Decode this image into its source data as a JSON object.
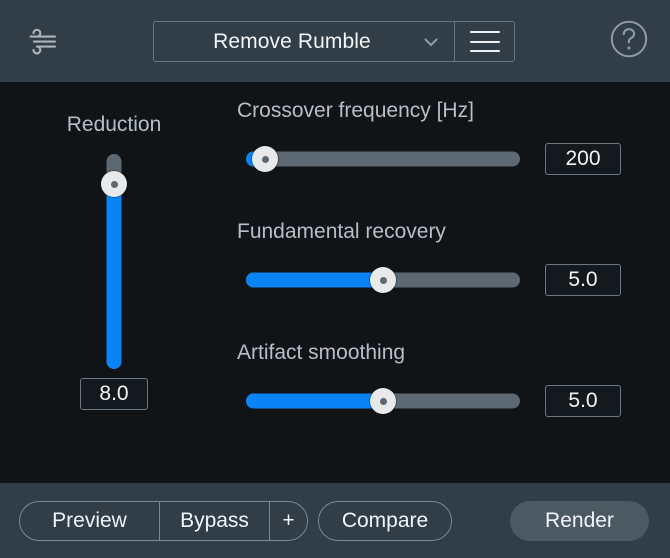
{
  "header": {
    "plugin_icon": "wind-noise-icon",
    "preset_name": "Remove Rumble",
    "dropdown_icon": "chevron-down-icon",
    "menu_icon": "hamburger-menu-icon",
    "help_icon": "help-circle-icon"
  },
  "colors": {
    "accent_blue": "#0a84f5",
    "track_gray": "#5c6872",
    "panel_dark": "#101417",
    "chrome_slate": "#313d47",
    "thumb_white": "#e7e9eb",
    "text_primary": "#f2f5f7",
    "text_label": "#b6bfc7",
    "render_fill": "#4b5963"
  },
  "reduction": {
    "label": "Reduction",
    "value": "8.0",
    "orientation": "vertical",
    "fill_percent": 86
  },
  "parameters": [
    {
      "label": "Crossover frequency [Hz]",
      "value": "200",
      "fill_percent": 7,
      "thumb_percent": 7
    },
    {
      "label": "Fundamental recovery",
      "value": "5.0",
      "fill_percent": 50,
      "thumb_percent": 50
    },
    {
      "label": "Artifact smoothing",
      "value": "5.0",
      "fill_percent": 50,
      "thumb_percent": 50
    }
  ],
  "footer": {
    "preview_label": "Preview",
    "bypass_label": "Bypass",
    "plus_label": "+",
    "compare_label": "Compare",
    "render_label": "Render"
  }
}
